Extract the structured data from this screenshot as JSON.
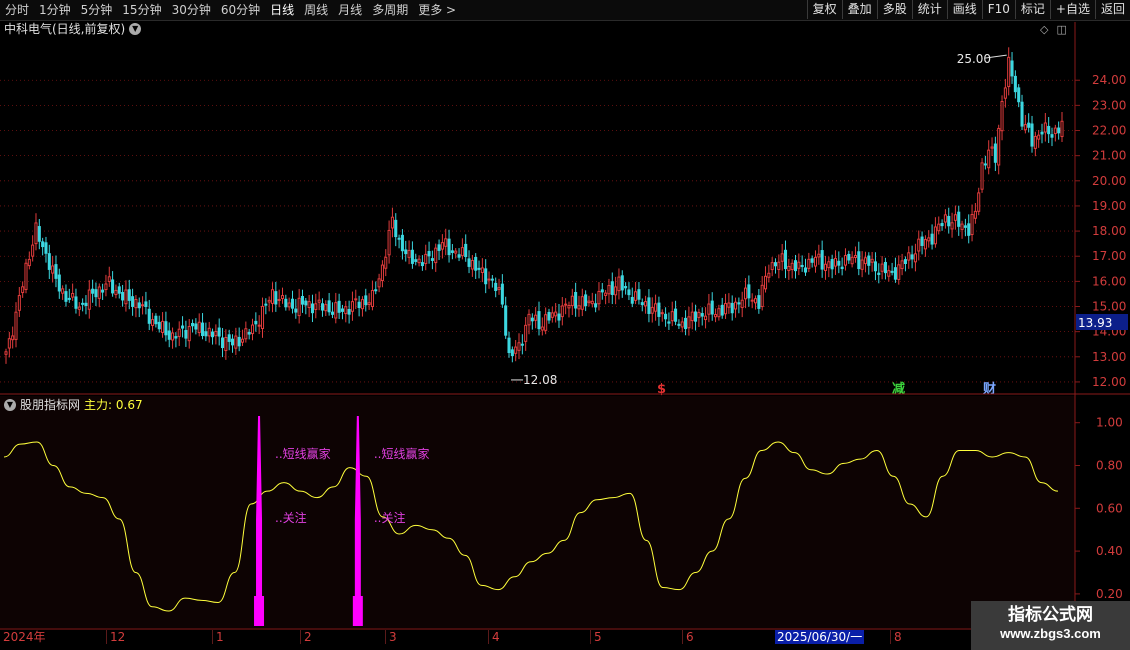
{
  "toolbar": {
    "periods": [
      {
        "label": "分时",
        "active": false
      },
      {
        "label": "1分钟",
        "active": false
      },
      {
        "label": "5分钟",
        "active": false
      },
      {
        "label": "15分钟",
        "active": false
      },
      {
        "label": "30分钟",
        "active": false
      },
      {
        "label": "60分钟",
        "active": false
      },
      {
        "label": "日线",
        "active": true
      },
      {
        "label": "周线",
        "active": false
      },
      {
        "label": "月线",
        "active": false
      },
      {
        "label": "多周期",
        "active": false
      },
      {
        "label": "更多 >",
        "active": false
      }
    ],
    "actions": [
      "复权",
      "叠加",
      "多股",
      "统计",
      "画线",
      "F10",
      "标记",
      "+自选",
      "返回"
    ]
  },
  "main_chart": {
    "title": "中科电气(日线,前复权)",
    "current_price": "13.93",
    "high_label": "25.00",
    "low_label": "12.08",
    "markers": [
      {
        "text": "$",
        "color": "#e03030"
      },
      {
        "text": "减",
        "color": "#3cd23c"
      },
      {
        "text": "财",
        "color": "#7aa6ff"
      }
    ]
  },
  "indicator": {
    "name": "股朋指标网",
    "value_label": "主力: 0.67",
    "annotations": {
      "signal": "短线赢家",
      "watch": "关注"
    }
  },
  "date_axis": {
    "labels": [
      "2024年",
      "12",
      "1",
      "2",
      "3",
      "4",
      "5",
      "6",
      "8"
    ],
    "highlight": "2025/06/30/一"
  },
  "watermark": {
    "line1": "指标公式网",
    "line2": "www.zbgs3.com"
  },
  "colors": {
    "up": "#e03c3c",
    "down": "#3cd7e0",
    "indicator": "#ffff3c",
    "signal": "#ff00ff",
    "grid": "#7a1414",
    "axis_text": "#d23c3c"
  },
  "chart_data": [
    {
      "type": "candlestick",
      "price_axis": {
        "ticks": [
          12.0,
          13.0,
          14.0,
          15.0,
          16.0,
          17.0,
          18.0,
          19.0,
          20.0,
          21.0,
          22.0,
          23.0,
          24.0
        ],
        "ylim": [
          11.6,
          25.6
        ]
      },
      "x_axis": {
        "labels": [
          "2024年",
          "12",
          "1",
          "2",
          "3",
          "4",
          "5",
          "6",
          "8"
        ]
      },
      "close_anchors": [
        [
          0,
          13.2
        ],
        [
          3,
          14.6
        ],
        [
          6,
          16.6
        ],
        [
          9,
          18.0
        ],
        [
          12,
          17.1
        ],
        [
          15,
          16.0
        ],
        [
          18,
          15.4
        ],
        [
          22,
          15.0
        ],
        [
          27,
          15.6
        ],
        [
          31,
          15.9
        ],
        [
          35,
          15.4
        ],
        [
          40,
          15.1
        ],
        [
          45,
          14.3
        ],
        [
          50,
          13.8
        ],
        [
          56,
          14.2
        ],
        [
          62,
          13.9
        ],
        [
          68,
          13.5
        ],
        [
          74,
          14.1
        ],
        [
          80,
          15.5
        ],
        [
          85,
          15.0
        ],
        [
          90,
          15.1
        ],
        [
          95,
          15.0
        ],
        [
          100,
          14.8
        ],
        [
          105,
          15.1
        ],
        [
          110,
          15.3
        ],
        [
          113,
          16.6
        ],
        [
          116,
          18.4
        ],
        [
          118,
          17.6
        ],
        [
          121,
          16.9
        ],
        [
          126,
          16.8
        ],
        [
          131,
          17.5
        ],
        [
          134,
          17.2
        ],
        [
          138,
          17.0
        ],
        [
          142,
          16.4
        ],
        [
          146,
          16.0
        ],
        [
          149,
          15.2
        ],
        [
          151,
          13.0
        ],
        [
          154,
          13.4
        ],
        [
          157,
          14.6
        ],
        [
          160,
          14.3
        ],
        [
          165,
          14.7
        ],
        [
          170,
          15.2
        ],
        [
          175,
          15.1
        ],
        [
          180,
          15.6
        ],
        [
          184,
          15.9
        ],
        [
          188,
          15.4
        ],
        [
          193,
          15.0
        ],
        [
          198,
          14.6
        ],
        [
          203,
          14.3
        ],
        [
          208,
          14.7
        ],
        [
          213,
          14.8
        ],
        [
          218,
          15.0
        ],
        [
          223,
          15.5
        ],
        [
          226,
          15.1
        ],
        [
          229,
          16.6
        ],
        [
          233,
          16.8
        ],
        [
          238,
          16.5
        ],
        [
          243,
          16.9
        ],
        [
          248,
          16.6
        ],
        [
          253,
          16.9
        ],
        [
          258,
          16.8
        ],
        [
          262,
          16.5
        ],
        [
          266,
          16.3
        ],
        [
          270,
          16.8
        ],
        [
          274,
          17.4
        ],
        [
          278,
          17.8
        ],
        [
          282,
          18.5
        ],
        [
          286,
          18.3
        ],
        [
          289,
          18.1
        ],
        [
          291,
          18.7
        ],
        [
          293,
          20.6
        ],
        [
          295,
          21.2
        ],
        [
          297,
          20.9
        ],
        [
          299,
          23.2
        ],
        [
          301,
          24.6
        ],
        [
          303,
          23.7
        ],
        [
          305,
          22.4
        ],
        [
          308,
          21.6
        ],
        [
          311,
          22.0
        ],
        [
          314,
          21.9
        ],
        [
          317,
          22.2
        ]
      ],
      "price_labels": {
        "high": 25.0,
        "low": 12.08,
        "current": 13.93
      }
    },
    {
      "type": "line",
      "series": [
        {
          "name": "主力",
          "values": [
            0.84,
            0.9,
            0.91,
            0.8,
            0.7,
            0.67,
            0.65,
            0.55,
            0.3,
            0.14,
            0.12,
            0.18,
            0.17,
            0.16,
            0.3,
            0.62,
            0.68,
            0.72,
            0.68,
            0.65,
            0.7,
            0.79,
            0.75,
            0.56,
            0.48,
            0.52,
            0.5,
            0.46,
            0.38,
            0.24,
            0.22,
            0.28,
            0.35,
            0.39,
            0.45,
            0.58,
            0.64,
            0.65,
            0.67,
            0.45,
            0.23,
            0.22,
            0.3,
            0.4,
            0.55,
            0.74,
            0.87,
            0.91,
            0.86,
            0.78,
            0.76,
            0.81,
            0.83,
            0.87,
            0.75,
            0.62,
            0.56,
            0.75,
            0.87,
            0.87,
            0.84,
            0.86,
            0.84,
            0.72,
            0.68
          ]
        }
      ],
      "y_axis": {
        "ticks": [
          0.2,
          0.4,
          0.6,
          0.8,
          1.0
        ],
        "ylim": [
          0.05,
          1.05
        ]
      },
      "signals": [
        {
          "index": 15,
          "label": "短线赢家",
          "sub_label": "关注"
        },
        {
          "index": 21,
          "label": "短线赢家",
          "sub_label": "关注"
        }
      ],
      "current_value": 0.67
    }
  ]
}
